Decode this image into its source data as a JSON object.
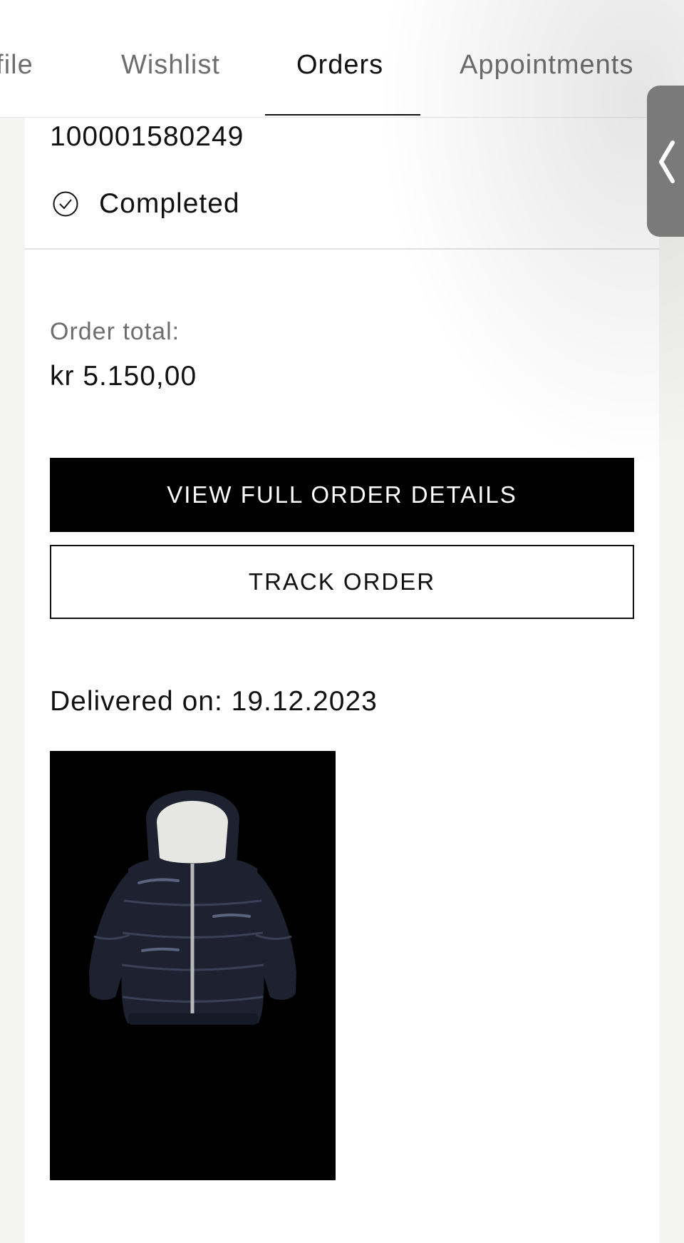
{
  "tabs": [
    {
      "label": "ofile",
      "active": false
    },
    {
      "label": "Wishlist",
      "active": false
    },
    {
      "label": "Orders",
      "active": true
    },
    {
      "label": "Appointments",
      "active": false
    }
  ],
  "order": {
    "number": "100001580249",
    "status": "Completed",
    "status_icon": "check-circle-icon",
    "total_label": "Order total:",
    "total_value": "kr 5.150,00",
    "view_details_label": "VIEW FULL ORDER DETAILS",
    "track_order_label": "TRACK ORDER",
    "delivered": "Delivered on: 19.12.2023"
  },
  "product": {
    "image": "navy puffer jacket with hood",
    "background_color": "#000000",
    "jacket_color": "#1d2130"
  },
  "side_handle": {
    "icon": "chevron-left-icon"
  },
  "colors": {
    "primary_button": "#000000",
    "text": "#111111",
    "muted_text": "#6e6e6e",
    "page_background": "#f4f4f2"
  }
}
